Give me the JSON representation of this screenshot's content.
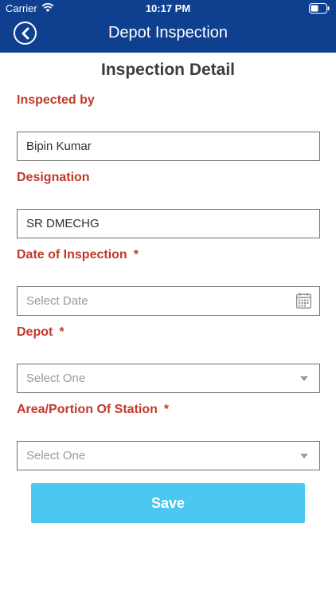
{
  "status_bar": {
    "carrier": "Carrier",
    "time": "10:17 PM"
  },
  "nav": {
    "title": "Depot Inspection",
    "back_icon": "chevron-left-icon"
  },
  "form": {
    "title": "Inspection Detail",
    "fields": [
      {
        "label": "Inspected by",
        "value": "Bipin Kumar"
      },
      {
        "label": "Designation",
        "value": "SR DMECHG"
      },
      {
        "label": "Date of Inspection",
        "required_mark": "*",
        "placeholder": "Select Date",
        "icon": "calendar-icon"
      },
      {
        "label": "Depot",
        "required_mark": "*",
        "placeholder": "Select One",
        "icon": "caret-down-icon"
      },
      {
        "label": "Area/Portion Of Station",
        "required_mark": "*",
        "placeholder": "Select One",
        "icon": "caret-down-icon"
      }
    ],
    "save_label": "Save"
  },
  "colors": {
    "header": "#0f3f8f",
    "label": "#c23a2b",
    "save_button": "#4cc8f0"
  }
}
